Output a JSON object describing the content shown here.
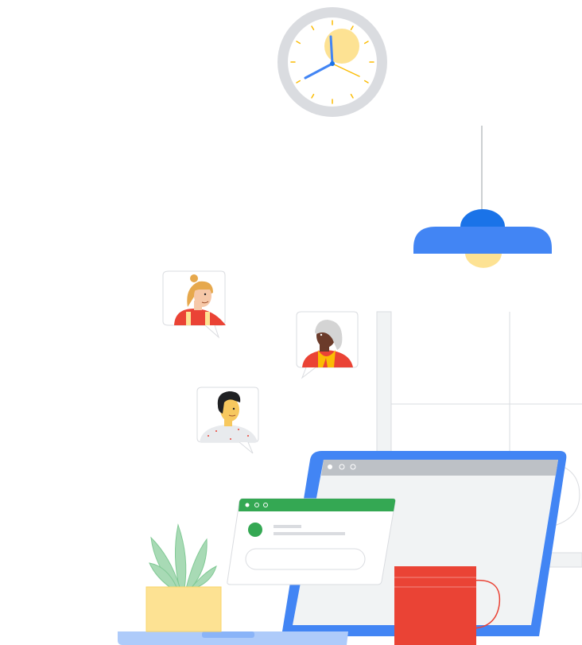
{
  "scene": {
    "colors": {
      "clock_rim": "#DADCE0",
      "clock_face": "#FFFFFF",
      "clock_sun": "#FDE293",
      "clock_hand": "#4285F4",
      "clock_second_hand": "#FBBC04",
      "lamp_shade": "#4285F4",
      "lamp_top": "#1A73E8",
      "lamp_bulb": "#FDE293",
      "laptop_frame": "#4285F4",
      "laptop_screen": "#F1F3F4",
      "laptop_titlebar": "#BDC1C6",
      "small_window_header": "#34A853",
      "avatar_dot": "#34A853",
      "mug": "#EA4335",
      "plant_leaves": "#A8DAB5",
      "plant_pot": "#FDE293",
      "desk": "#AECBFA",
      "steam": "#FFFFFF",
      "bubble_border": "#DADCE0"
    },
    "icons": {
      "clock": "wall-clock-icon",
      "lamp": "pendant-lamp-icon",
      "plant": "potted-plant-icon",
      "mug": "coffee-mug-icon",
      "laptop": "laptop-icon"
    },
    "people": [
      {
        "name": "person-woman-blonde",
        "hair": "#E6A84C",
        "skin": "#F6C8A8",
        "shirt": "#EA4335"
      },
      {
        "name": "person-woman-elder",
        "hair": "#D4D4D4",
        "skin": "#6B3B2A",
        "shirt": "#EA4335",
        "scarf": "#FBBC04"
      },
      {
        "name": "person-man-dark-hair",
        "hair": "#202124",
        "skin": "#F7C85E",
        "shirt": "#E8EAED"
      }
    ]
  }
}
